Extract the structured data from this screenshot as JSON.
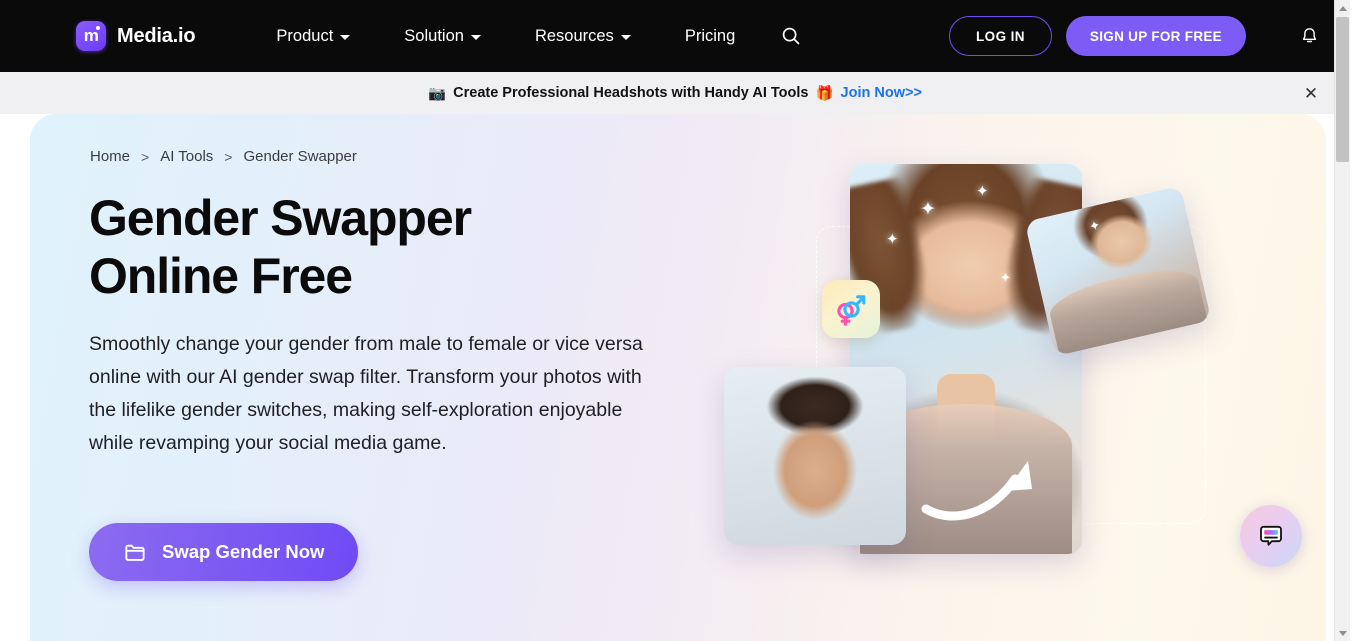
{
  "nav": {
    "brand": "Media.io",
    "logo_icon": "media-io-logo-icon",
    "items": [
      {
        "label": "Product",
        "has_dropdown": true
      },
      {
        "label": "Solution",
        "has_dropdown": true
      },
      {
        "label": "Resources",
        "has_dropdown": true
      },
      {
        "label": "Pricing",
        "has_dropdown": false
      }
    ],
    "search_icon": "search-icon",
    "login_label": "LOG IN",
    "signup_label": "SIGN UP FOR FREE",
    "bell_icon": "bell-icon",
    "accent_purple": "#7c5cf5",
    "background": "#0a0a0a"
  },
  "announcement": {
    "camera_emoji": "📷",
    "text": "Create Professional Headshots with Handy AI Tools",
    "gift_emoji": "🎁",
    "link_label": "Join Now>>",
    "link_color": "#1a73e8",
    "close_icon": "close-icon",
    "background": "#f0f0f2"
  },
  "hero": {
    "breadcrumb": [
      {
        "label": "Home"
      },
      {
        "label": "AI Tools"
      },
      {
        "label": "Gender Swapper"
      }
    ],
    "breadcrumb_separator": ">",
    "title_line1": "Gender Swapper",
    "title_line2": "Online Free",
    "description": "Smoothly change your gender from male to female or vice versa online with our AI gender swap filter. Transform your photos with the lifelike gender switches, making self-exploration enjoyable while revamping your social media game.",
    "cta_label": "Swap Gender Now",
    "cta_icon": "folder-icon",
    "cta_gradient_start": "#8b6cf0",
    "cta_gradient_end": "#6f4bf5",
    "artwork": {
      "gender_badge_icon": "gender-symbol-icon",
      "arrow_icon": "curved-arrow-icon",
      "cards": [
        {
          "name": "woman-result-photo"
        },
        {
          "name": "woman-variant-photo"
        },
        {
          "name": "man-source-photo"
        }
      ]
    }
  },
  "chat_widget": {
    "icon": "chat-bubble-icon"
  },
  "scrollbar": {
    "up_icon": "scroll-up-arrow-icon",
    "down_icon": "scroll-down-arrow-icon"
  }
}
